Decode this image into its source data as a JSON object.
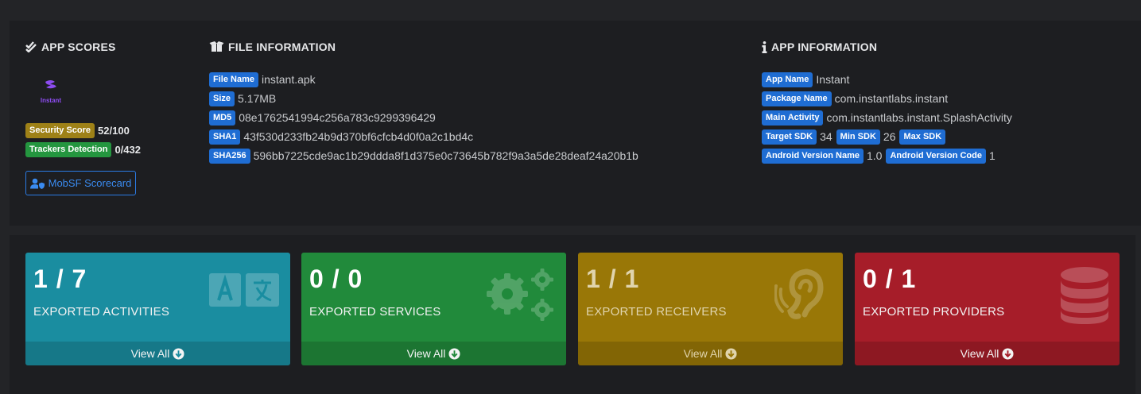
{
  "app_scores": {
    "title": "APP SCORES",
    "logo_text": "Instant",
    "security_score_label": "Security Score",
    "security_score_value": "52/100",
    "trackers_label": "Trackers Detection",
    "trackers_value": "0/432",
    "scorecard_button": "MobSF Scorecard"
  },
  "file_info": {
    "title": "FILE INFORMATION",
    "rows": [
      {
        "label": "File Name",
        "value": "instant.apk"
      },
      {
        "label": "Size",
        "value": "5.17MB"
      },
      {
        "label": "MD5",
        "value": "08e1762541994c256a783c9299396429"
      },
      {
        "label": "SHA1",
        "value": "43f530d233fb24b9d370bf6cfcb4d0f0a2c1bd4c"
      },
      {
        "label": "SHA256",
        "value": "596bb7225cde9ac1b29ddda8f1d375e0c73645b782f9a3a5de28deaf24a20b1b"
      }
    ]
  },
  "app_info": {
    "title": "APP INFORMATION",
    "app_name_label": "App Name",
    "app_name": "Instant",
    "package_label": "Package Name",
    "package": "com.instantlabs.instant",
    "main_activity_label": "Main Activity",
    "main_activity": "com.instantlabs.instant.SplashActivity",
    "target_sdk_label": "Target SDK",
    "target_sdk": "34",
    "min_sdk_label": "Min SDK",
    "min_sdk": "26",
    "max_sdk_label": "Max SDK",
    "version_name_label": "Android Version Name",
    "version_name": "1.0",
    "version_code_label": "Android Version Code",
    "version_code": "1"
  },
  "cards": [
    {
      "count": "1 / 7",
      "label": "EXPORTED ACTIVITIES",
      "link": "View All",
      "icon": "language-icon",
      "color": "#1a8da0"
    },
    {
      "count": "0 / 0",
      "label": "EXPORTED SERVICES",
      "link": "View All",
      "icon": "cogs-icon",
      "color": "#218a3b"
    },
    {
      "count": "1 / 1",
      "label": "EXPORTED RECEIVERS",
      "link": "View All",
      "icon": "ear-icon",
      "color": "#997707"
    },
    {
      "count": "0 / 1",
      "label": "EXPORTED PROVIDERS",
      "link": "View All",
      "icon": "database-icon",
      "color": "#a61d29"
    }
  ]
}
